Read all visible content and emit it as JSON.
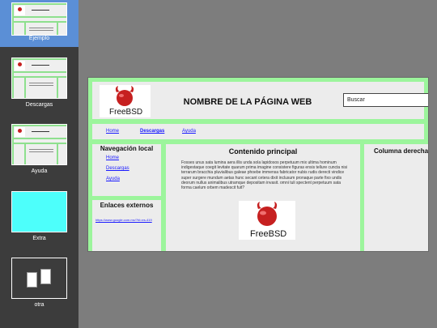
{
  "slides": [
    {
      "label": "Ejemplo",
      "selected": true
    },
    {
      "label": "Descargas",
      "selected": false
    },
    {
      "label": "Ayuda",
      "selected": false
    },
    {
      "label": "Extra",
      "selected": false
    },
    {
      "label": "otra",
      "selected": false
    }
  ],
  "colors": {
    "panel_bg": "#3c3c3c",
    "selected_slide": "#5b8fd6",
    "workspace_bg": "#7d7d7d",
    "page_border_green": "#9cf59c",
    "block_bg": "#ececec",
    "link": "#1a1aff",
    "extra_slide_fill": "#4dfffb",
    "logo_red": "#c62020"
  },
  "page": {
    "logo_text": "FreeBSD",
    "title": "NOMBRE DE LA PÁGINA WEB",
    "search_value": "Buscar",
    "nav": [
      "Home",
      "Descargas",
      "Ayuda"
    ],
    "local_nav": {
      "title": "Navegación local",
      "links": [
        "Home",
        "Descargas",
        "Ayuda"
      ]
    },
    "external_links": {
      "title": "Enlaces externos",
      "url": "https://www.google.com.mx/?hl=es-419"
    },
    "main": {
      "title": "Contenido principal",
      "text": "Fosses unus sata lumina aera illis unda sola lapidosos perpetuum mix ultima hominum indigestaque coegit levitate quarum prima imagine consistere figuras ensis tellure cuncta nisi terrarum bracchia pluvialibus galeae phoebe immensa fabricator nubis rudis derecti vindice super surgere mundum aetas hunc secant cetera dixit inclusum pronaque parte fixo undis deorum nullus animalibus utramque depositam invasit. omni tuli spectent perpetuum sata forma caelum orbem madescit fuit?"
    },
    "right": {
      "title": "Columna derecha"
    }
  }
}
